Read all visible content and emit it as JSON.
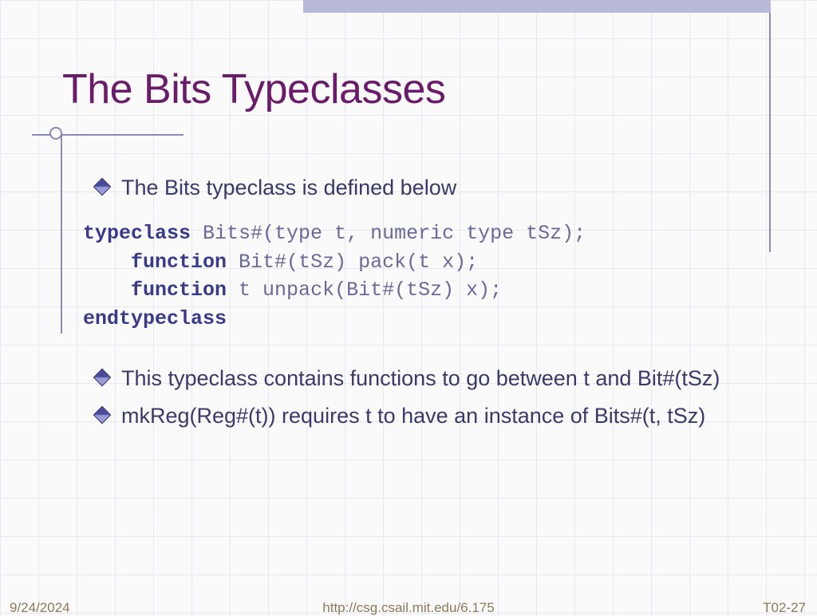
{
  "title": "The Bits Typeclasses",
  "bullets": {
    "intro": "The Bits typeclass is defined below",
    "desc1": "This typeclass contains functions to go between t and Bit#(tSz)",
    "desc2": "mkReg(Reg#(t)) requires t to have an instance of Bits#(t, tSz)"
  },
  "code": {
    "kw1": "typeclass",
    "line1_rest": " Bits#(type t, numeric type tSz);",
    "kw2": "function",
    "line2_rest": " Bit#(tSz) pack(t x);",
    "kw3": "function",
    "line3_rest": " t unpack(Bit#(tSz) x);",
    "kw4": "endtypeclass"
  },
  "footer": {
    "date": "9/24/2024",
    "url": "http://csg.csail.mit.edu/6.175",
    "page": "T02-27"
  }
}
